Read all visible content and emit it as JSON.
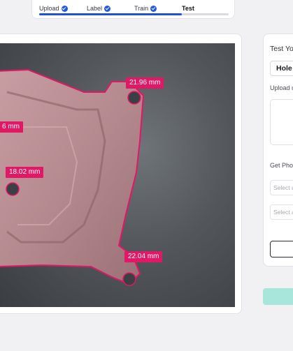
{
  "stepper": {
    "steps": [
      {
        "label": "Upload",
        "done": true
      },
      {
        "label": "Label",
        "done": true
      },
      {
        "label": "Train",
        "done": true
      },
      {
        "label": "Test",
        "done": false
      }
    ],
    "progress_percent": 75,
    "check_color": "#2457e6"
  },
  "viewer": {
    "highlight_color": "#e11865",
    "measurements": [
      "21.96 mm",
      "6 mm",
      "18.02 mm",
      "22.04 mm"
    ]
  },
  "panel": {
    "title": "Test Yo",
    "mode_value": "Hole I",
    "upload_label": "Upload u",
    "photos_label": "Get Phot",
    "select_1_placeholder": "Select a",
    "select_2_placeholder": "Select a",
    "primary_button_color": "#a8e6dc"
  }
}
